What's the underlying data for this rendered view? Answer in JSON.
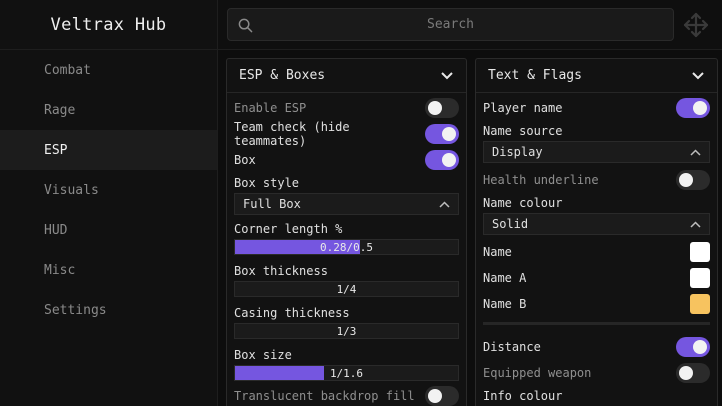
{
  "app": {
    "title": "Veltrax Hub"
  },
  "search": {
    "placeholder": "Search"
  },
  "sidebar": {
    "items": [
      {
        "label": "Combat",
        "active": false
      },
      {
        "label": "Rage",
        "active": false
      },
      {
        "label": "ESP",
        "active": true
      },
      {
        "label": "Visuals",
        "active": false
      },
      {
        "label": "HUD",
        "active": false
      },
      {
        "label": "Misc",
        "active": false
      },
      {
        "label": "Settings",
        "active": false
      }
    ]
  },
  "esp_panel": {
    "title": "ESP & Boxes",
    "enable_esp": {
      "label": "Enable ESP",
      "on": false
    },
    "team_check": {
      "label": "Team check (hide teammates)",
      "on": true
    },
    "box": {
      "label": "Box",
      "on": true
    },
    "box_style": {
      "label": "Box style",
      "value": "Full Box"
    },
    "corner_length": {
      "label": "Corner length %",
      "text": "0.28/0.5",
      "fraction": 0.56
    },
    "box_thickness": {
      "label": "Box thickness",
      "text": "1/4",
      "fraction": 0.0
    },
    "casing_thickness": {
      "label": "Casing thickness",
      "text": "1/3",
      "fraction": 0.0
    },
    "box_size": {
      "label": "Box size",
      "text": "1/1.6",
      "fraction": 0.4
    },
    "translucent_fill": {
      "label": "Translucent backdrop fill",
      "on": false
    }
  },
  "text_panel": {
    "title": "Text & Flags",
    "player_name": {
      "label": "Player name",
      "on": true
    },
    "name_source": {
      "label": "Name source",
      "value": "Display"
    },
    "health_underline": {
      "label": "Health underline",
      "on": false
    },
    "name_colour": {
      "label": "Name colour",
      "value": "Solid"
    },
    "name_swatch": {
      "label": "Name",
      "color": "#ffffff"
    },
    "name_a_swatch": {
      "label": "Name A",
      "color": "#ffffff"
    },
    "name_b_swatch": {
      "label": "Name B",
      "color": "#f7c35f"
    },
    "distance": {
      "label": "Distance",
      "on": true
    },
    "equipped_weapon": {
      "label": "Equipped weapon",
      "on": false
    },
    "info_colour": {
      "label": "Info colour"
    }
  },
  "colors": {
    "accent": "#7556e0",
    "background": "#0d0d0d",
    "panel": "#121212"
  }
}
